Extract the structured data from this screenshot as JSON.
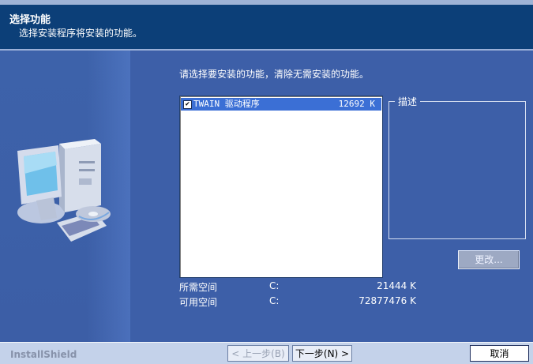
{
  "header": {
    "title": "选择功能",
    "subtitle": "选择安装程序将安装的功能。"
  },
  "main": {
    "instruction": "请选择要安装的功能，清除无需安装的功能。",
    "features": [
      {
        "name": "TWAIN 驱动程序",
        "size": "12692 K",
        "checked": true
      }
    ],
    "description_label": "描述",
    "change_button": "更改...",
    "space_required": {
      "label": "所需空间",
      "drive": "C:",
      "value": "21444 K"
    },
    "space_available": {
      "label": "可用空间",
      "drive": "C:",
      "value": "72877476 K"
    }
  },
  "footer": {
    "brand": "InstallShield",
    "back_button": "< 上一步(B)",
    "next_button": "下一步(N) >",
    "cancel_button": "取消"
  },
  "icons": {
    "computer": "computer-with-cd-icon",
    "checkbox": "checkbox-checked-icon"
  },
  "colors": {
    "header_bg": "#0c3f78",
    "panel_bg": "#3d5fa8",
    "selection": "#3b6fd5",
    "footer_bg": "#c4d2ea"
  }
}
